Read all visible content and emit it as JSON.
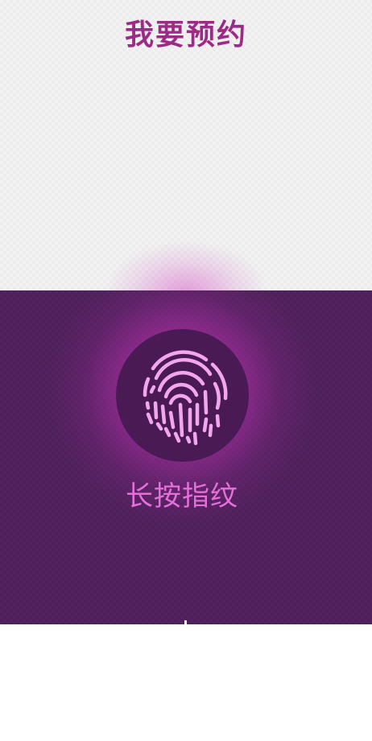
{
  "header": {
    "title": "我要预约"
  },
  "fingerprint_panel": {
    "icon": "fingerprint-icon",
    "hint_text": "长按指纹"
  },
  "colors": {
    "title": "#9d2a86",
    "panel_background": "#4e1f5a",
    "button_background": "#4a1a55",
    "glow": "#d646c8",
    "fingerprint_lines": "#f2a6ee",
    "hint_text": "#e46fd9",
    "top_background": "#f2f2f2"
  }
}
